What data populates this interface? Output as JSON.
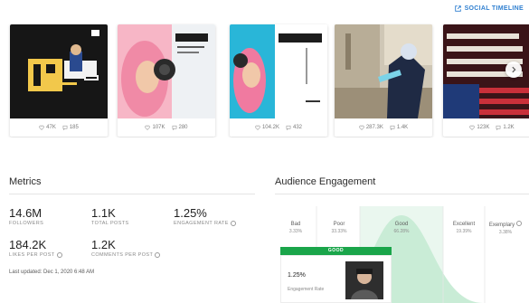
{
  "header": {
    "social_timeline_label": "SOCIAL TIMELINE",
    "link_icon": "external-link-icon"
  },
  "posts": [
    {
      "thumb": "post-thumbnail-launch-party",
      "likes": "47K",
      "comments": "185"
    },
    {
      "thumb": "post-thumbnail-ninja-headphones-pink",
      "likes": "107K",
      "comments": "280"
    },
    {
      "thumb": "post-thumbnail-ninja-headphones-blue",
      "likes": "104.2K",
      "comments": "432"
    },
    {
      "thumb": "post-thumbnail-game-scene",
      "likes": "287.3K",
      "comments": "1.4K"
    },
    {
      "thumb": "post-thumbnail-flag-text",
      "likes": "123K",
      "comments": "1.2K"
    }
  ],
  "metrics": {
    "title": "Metrics",
    "followers": {
      "value": "14.6M",
      "label": "FOLLOWERS"
    },
    "total_posts": {
      "value": "1.1K",
      "label": "TOTAL POSTS"
    },
    "engagement_rate": {
      "value": "1.25%",
      "label": "ENGAGEMENT RATE"
    },
    "likes_per_post": {
      "value": "184.2K",
      "label": "LIKES PER POST"
    },
    "comments_per_post": {
      "value": "1.2K",
      "label": "COMMENTS PER POST"
    },
    "last_updated": "Last updated: Dec 1, 2020 6:48 AM"
  },
  "engagement": {
    "title": "Audience Engagement",
    "badge": "GOOD",
    "rate_value": "1.25%",
    "rate_label": "Engagement Rate",
    "columns": [
      {
        "name": "Bad",
        "range": "3.33%"
      },
      {
        "name": "Poor",
        "range": "33.33%"
      },
      {
        "name": "Good",
        "range": "66.28%"
      },
      {
        "name": "Excellent",
        "range": "19.39%"
      },
      {
        "name": "Exemplary",
        "range": "3.38%"
      }
    ],
    "colors": {
      "curve": "#c9ecd6",
      "badge": "#1aa54a",
      "good_band": "#eaf7ef"
    }
  },
  "colors": {
    "link": "#2f7fd0"
  }
}
